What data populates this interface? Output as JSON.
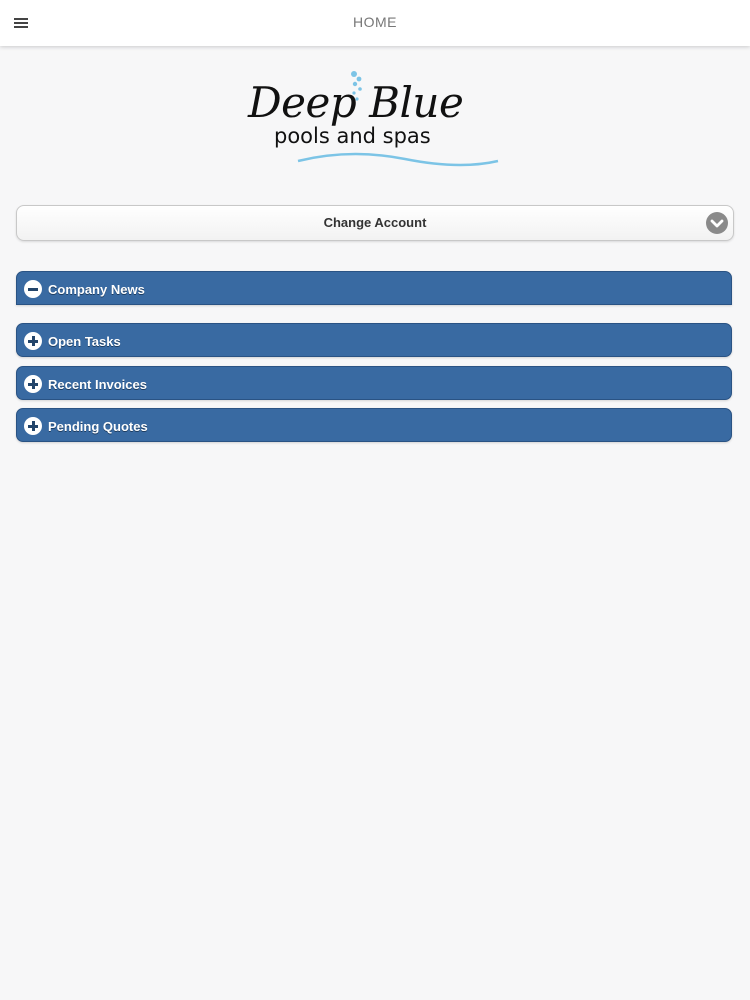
{
  "header": {
    "title": "HOME",
    "menu_icon": "hamburger-menu-icon"
  },
  "logo": {
    "main": "Deep Blue",
    "sub": "pools and spas",
    "accent_color": "#7cc4e6"
  },
  "account": {
    "label": "Change Account",
    "icon": "chevron-down-icon"
  },
  "sections": [
    {
      "label": "Company News",
      "expanded": true
    },
    {
      "label": "Open Tasks",
      "expanded": false
    },
    {
      "label": "Recent Invoices",
      "expanded": false
    },
    {
      "label": "Pending Quotes",
      "expanded": false
    }
  ],
  "colors": {
    "section_bar": "#396aa2",
    "background": "#f7f7f8"
  }
}
